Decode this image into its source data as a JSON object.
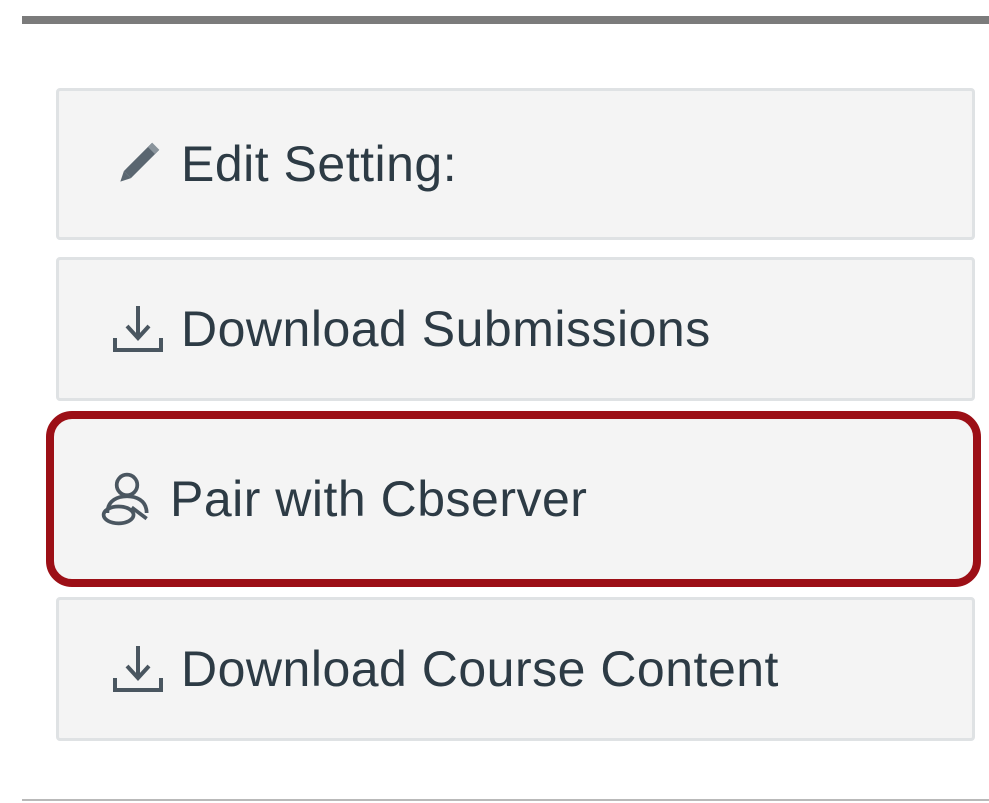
{
  "menu": {
    "items": [
      {
        "label": "Edit Setting:",
        "icon": "pencil-icon"
      },
      {
        "label": "Download Submissions",
        "icon": "download-icon"
      },
      {
        "label": "Pair with Cbserver",
        "icon": "observer-pair-icon",
        "focused": true
      },
      {
        "label": "Download Course Content",
        "icon": "download-icon"
      }
    ]
  },
  "colors": {
    "button_bg": "#f4f4f4",
    "button_border": "#dfe2e4",
    "text": "#2d3b45",
    "focus_ring": "#9c0f16"
  }
}
